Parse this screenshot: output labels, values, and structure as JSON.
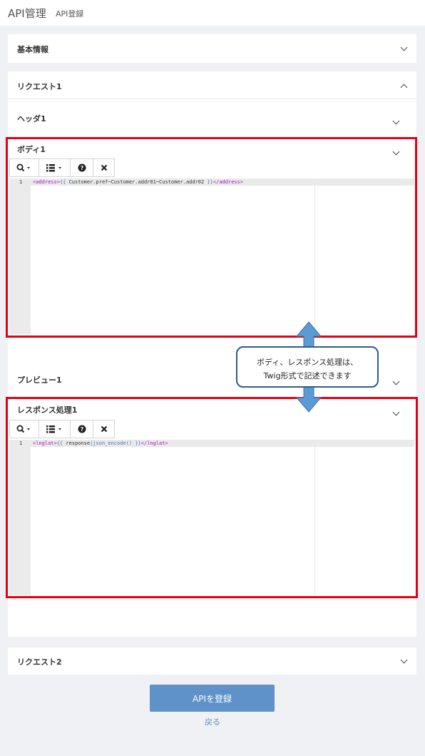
{
  "header": {
    "title": "API管理",
    "subtitle": "API登録"
  },
  "sections": {
    "basic": {
      "title": "基本情報"
    },
    "request1": {
      "title": "リクエスト1"
    },
    "header1": {
      "title": "ヘッダ1"
    },
    "body1": {
      "title": "ボディ1",
      "line_no": "1",
      "code": {
        "open_tag": "<address>",
        "twig_open": "{{ ",
        "expr": "Customer.pref~Customer.addr01~Customer.addr02",
        "twig_close": " }}",
        "close_tag": "</address>"
      }
    },
    "preview1": {
      "title": "プレビュー1"
    },
    "response1": {
      "title": "レスポンス処理1",
      "line_no": "1",
      "code": {
        "open_tag": "<lnglat>",
        "twig_open": "{{ ",
        "expr": "response",
        "filter": "|json_encode()",
        "twig_close": " }}",
        "close_tag": "</lnglat>"
      }
    },
    "request2": {
      "title": "リクエスト2"
    }
  },
  "callout": {
    "line1": "ボディ、レスポンス処理は、",
    "line2": "Twig形式で記述できます"
  },
  "actions": {
    "submit_label": "APIを登録",
    "back_label": "戻る"
  },
  "icons": [
    "search-icon",
    "list-icon",
    "help-icon",
    "close-icon",
    "chevron-down-icon",
    "chevron-up-icon"
  ],
  "colors": {
    "highlight_border": "#e60012",
    "callout_arrow": "#5b9bd5",
    "callout_border": "#2b5d8c",
    "primary_button": "#5e92c8"
  }
}
